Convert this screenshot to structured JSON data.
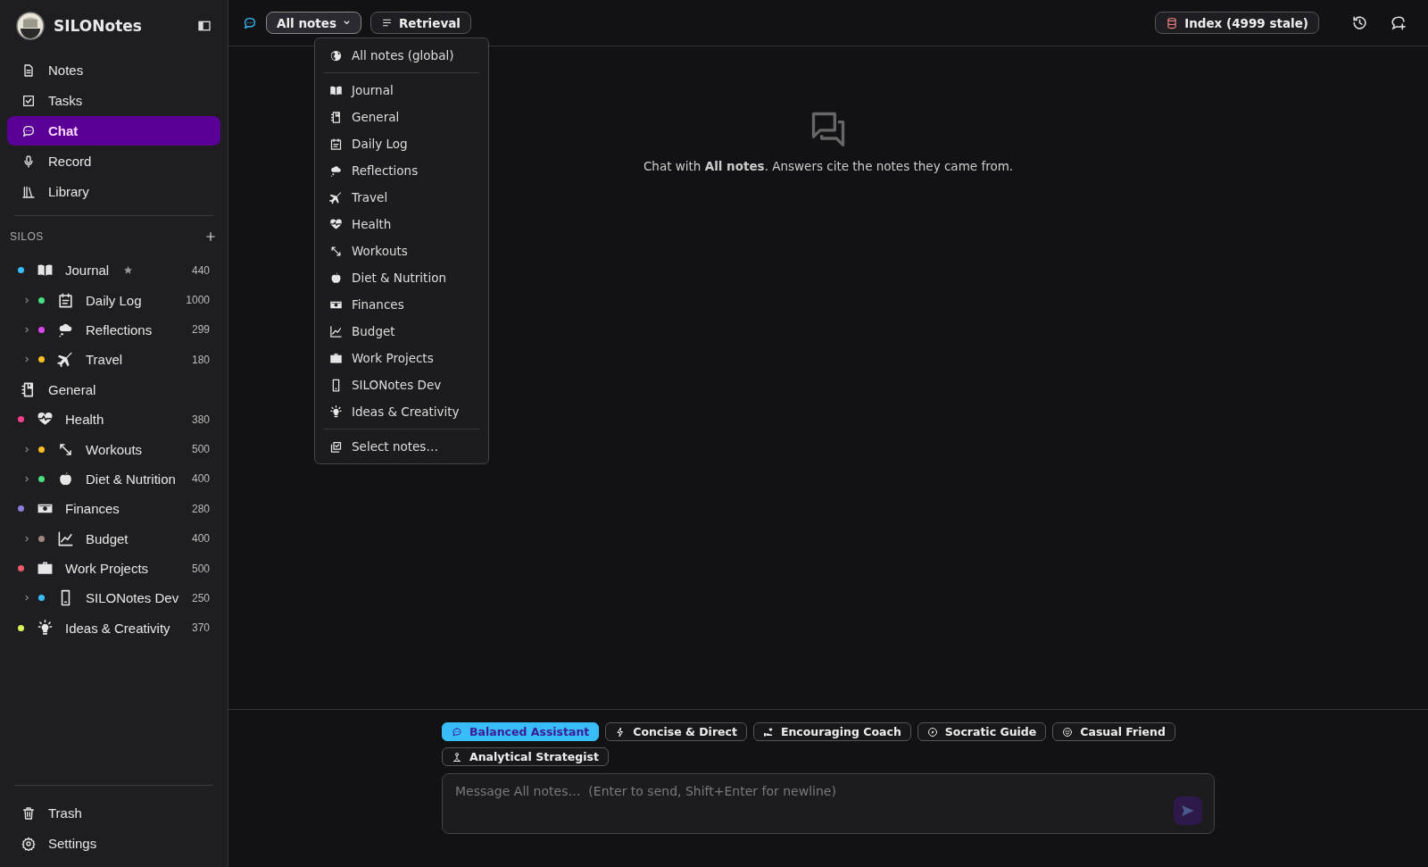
{
  "app": {
    "title": "SILONotes"
  },
  "nav": [
    {
      "label": "Notes",
      "selected": false
    },
    {
      "label": "Tasks",
      "selected": false
    },
    {
      "label": "Chat",
      "selected": true
    },
    {
      "label": "Record",
      "selected": false
    },
    {
      "label": "Library",
      "selected": false
    }
  ],
  "silos": {
    "heading": "SILOS",
    "items": [
      {
        "label": "Journal",
        "color": "#38bdf8",
        "count": "440",
        "starred": true,
        "children": [
          {
            "label": "Daily Log",
            "color": "#4ade80",
            "count": "1000",
            "starred": false,
            "expanded": false
          },
          {
            "label": "Reflections",
            "color": "#d946ef",
            "count": "299",
            "starred": false,
            "expanded": false
          },
          {
            "label": "Travel",
            "color": "#fbbf24",
            "count": "180",
            "starred": false,
            "expanded": false
          }
        ]
      },
      {
        "label": "General",
        "starred": false
      },
      {
        "label": "Health",
        "color": "#f43f8e",
        "count": "380",
        "starred": false,
        "children": [
          {
            "label": "Workouts",
            "color": "#fbbf24",
            "count": "500",
            "starred": false,
            "expanded": false
          },
          {
            "label": "Diet & Nutrition",
            "color": "#4ade80",
            "count": "400",
            "starred": false,
            "expanded": false
          }
        ]
      },
      {
        "label": "Finances",
        "color": "#8b7ddb",
        "count": "280",
        "starred": false,
        "children": [
          {
            "label": "Budget",
            "color": "#a1887f",
            "count": "400",
            "starred": false,
            "expanded": false
          }
        ]
      },
      {
        "label": "Work Projects",
        "color": "#f05a6a",
        "count": "500",
        "starred": false,
        "children": [
          {
            "label": "SILONotes Dev",
            "color": "#38bdf8",
            "count": "250",
            "starred": false,
            "expanded": false
          }
        ]
      },
      {
        "label": "Ideas & Creativity",
        "color": "#d9f55a",
        "count": "370",
        "starred": false
      }
    ]
  },
  "footer_nav": [
    {
      "label": "Trash"
    },
    {
      "label": "Settings"
    }
  ],
  "toolbar": {
    "scope_button": "All notes",
    "mode_button": "Retrieval",
    "index_badge": "Index (4999 stale)"
  },
  "scope_menu": {
    "global": "All notes (global)",
    "items": [
      "Journal",
      "General",
      "Daily Log",
      "Reflections",
      "Travel",
      "Health",
      "Workouts",
      "Diet & Nutrition",
      "Finances",
      "Budget",
      "Work Projects",
      "SILONotes Dev",
      "Ideas & Creativity"
    ],
    "select": "Select notes…"
  },
  "empty_state": {
    "text": "Chat with **All notes**. Answers cite the notes they came from."
  },
  "personas": [
    {
      "label": "Balanced Assistant",
      "selected": true
    },
    {
      "label": "Concise & Direct",
      "selected": false
    },
    {
      "label": "Encouraging Coach",
      "selected": false
    },
    {
      "label": "Socratic Guide",
      "selected": false
    },
    {
      "label": "Casual Friend",
      "selected": false
    },
    {
      "label": "Analytical Strategist",
      "selected": false
    }
  ],
  "composer": {
    "placeholder": "Message All notes…  (Enter to send, Shift+Enter for newline)",
    "send_disabled": true
  }
}
